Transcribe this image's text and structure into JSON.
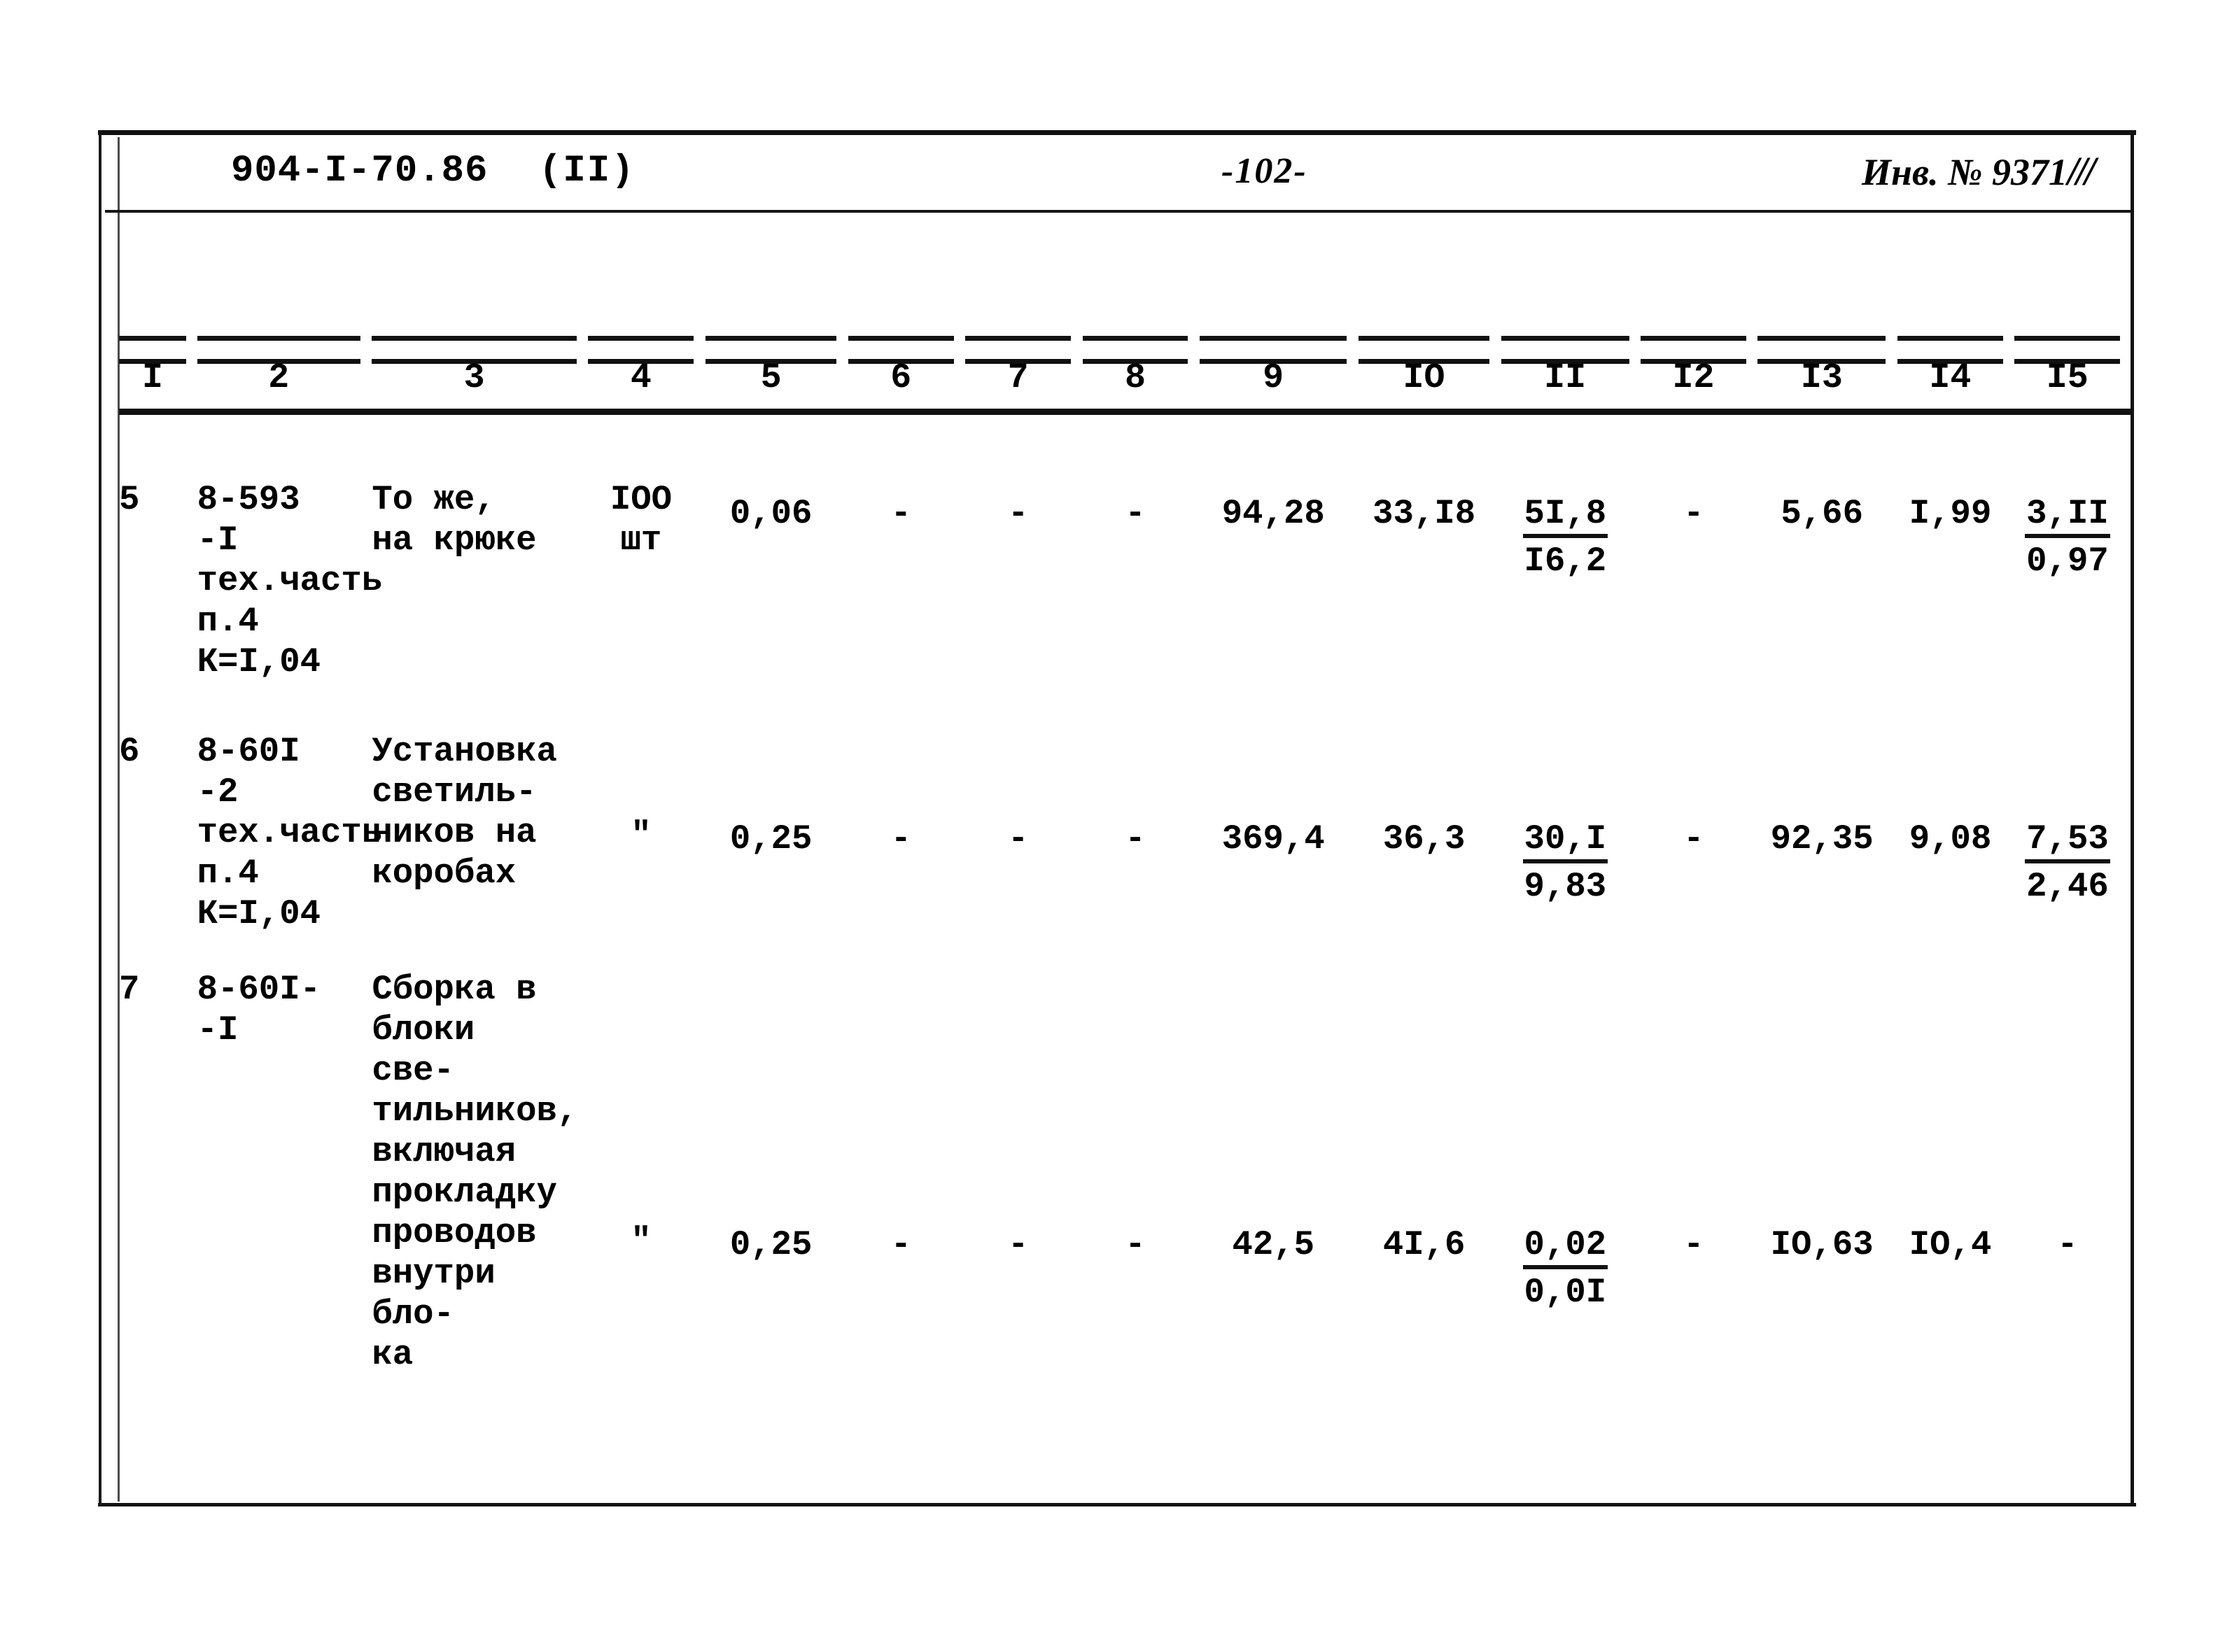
{
  "header": {
    "doc_code": "904-I-70.86",
    "part": "(II)",
    "page_number": "-102-",
    "inventory_label": "Инв. № 9371",
    "inventory_slashes": "///"
  },
  "table": {
    "column_numbers": [
      "I",
      "2",
      "3",
      "4",
      "5",
      "6",
      "7",
      "8",
      "9",
      "IO",
      "II",
      "I2",
      "I3",
      "I4",
      "I5"
    ],
    "rows": [
      {
        "no": "5",
        "code": "8-593\n-I\nтех.часть\nп.4\nК=I,04",
        "description": "То же,\nна крюке",
        "unit": "IOO\nшт",
        "c5": "0,06",
        "c6": "-",
        "c7": "-",
        "c8": "-",
        "c9": "94,28",
        "c10": "33,I8",
        "c11_top": "5I,8",
        "c11_bottom": "I6,2",
        "c12": "-",
        "c13": "5,66",
        "c14": "I,99",
        "c15_top": "3,II",
        "c15_bottom": "0,97"
      },
      {
        "no": "6",
        "code": "8-60I\n-2\nтех.часть\nп.4\nК=I,04",
        "description": "Установка\nсветиль-\nников на\nкоробах",
        "unit": "\"",
        "c5": "0,25",
        "c6": "-",
        "c7": "-",
        "c8": "-",
        "c9": "369,4",
        "c10": "36,3",
        "c11_top": "30,I",
        "c11_bottom": "9,83",
        "c12": "-",
        "c13": "92,35",
        "c14": "9,08",
        "c15_top": "7,53",
        "c15_bottom": "2,46"
      },
      {
        "no": "7",
        "code": "8-60I-\n-I",
        "description": "Сборка в\nблоки све-\nтильников,\nвключая\nпрокладку\nпроводов\nвнутри бло-\nка",
        "unit": "\"",
        "c5": "0,25",
        "c6": "-",
        "c7": "-",
        "c8": "-",
        "c9": "42,5",
        "c10": "4I,6",
        "c11_top": "0,02",
        "c11_bottom": "0,0I",
        "c12": "-",
        "c13": "IO,63",
        "c14": "IO,4",
        "c15_top": "-",
        "c15_bottom": ""
      }
    ]
  }
}
